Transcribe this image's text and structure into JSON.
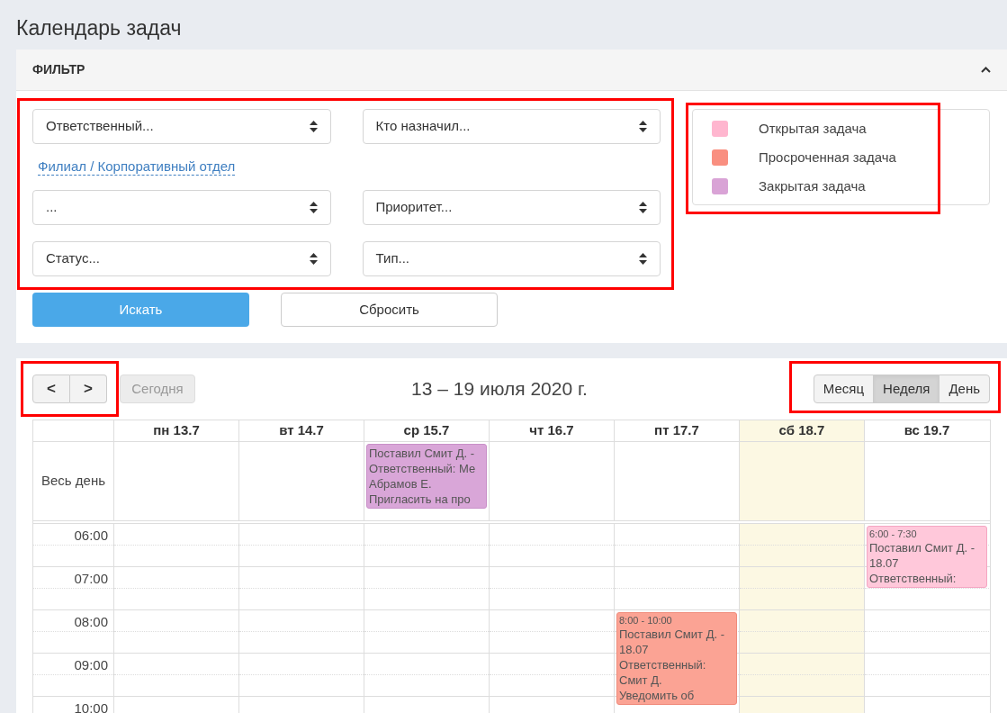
{
  "page_title": "Календарь задач",
  "filter": {
    "title": "ФИЛЬТР",
    "expanded": true,
    "highlighted": true,
    "selects_top": [
      {
        "placeholder": "Ответственный..."
      },
      {
        "placeholder": "Кто назначил..."
      }
    ],
    "branch_link": "Филиал / Корпоративный отдел",
    "selects_bottom": [
      {
        "placeholder": "..."
      },
      {
        "placeholder": "Приоритет..."
      },
      {
        "placeholder": "Статус..."
      },
      {
        "placeholder": "Тип..."
      }
    ],
    "search_button": "Искать",
    "reset_button": "Сбросить"
  },
  "legend": {
    "highlighted": true,
    "items": [
      {
        "label": "Открытая задача",
        "color": "#ffb6cf"
      },
      {
        "label": "Просроченная задача",
        "color": "#f98f80"
      },
      {
        "label": "Закрытая задача",
        "color": "#d9a3d6"
      }
    ]
  },
  "calendar": {
    "nav_highlighted": true,
    "views_highlighted": true,
    "prev": "<",
    "next": ">",
    "today_button": {
      "label": "Сегодня",
      "disabled": true
    },
    "title": "13 – 19 июля 2020 г.",
    "views": [
      {
        "label": "Месяц",
        "selected": false
      },
      {
        "label": "Неделя",
        "selected": true
      },
      {
        "label": "День",
        "selected": false
      }
    ],
    "days": [
      {
        "label": "пн 13.7",
        "today": false
      },
      {
        "label": "вт 14.7",
        "today": false
      },
      {
        "label": "ср 15.7",
        "today": false
      },
      {
        "label": "чт 16.7",
        "today": false
      },
      {
        "label": "пт 17.7",
        "today": false
      },
      {
        "label": "сб 18.7",
        "today": true
      },
      {
        "label": "вс 19.7",
        "today": false
      }
    ],
    "all_day": {
      "label": "Весь день",
      "cells": [
        null,
        null,
        {
          "kind": "closed",
          "lines": [
            "Поставил Смит Д. -",
            "Ответственный: Ме",
            "Абрамов Е.",
            "Пригласить на про"
          ]
        },
        null,
        null,
        null,
        null
      ]
    },
    "hours": [
      {
        "label": "06:00",
        "cells": [
          null,
          null,
          null,
          null,
          null,
          null,
          {
            "kind": "open",
            "time": "6:00 - 7:30",
            "lines": [
              "Поставил Смит Д. -",
              "18.07",
              "Ответственный:"
            ]
          }
        ]
      },
      {
        "label": "07:00",
        "cells": [
          null,
          null,
          null,
          null,
          null,
          null,
          null
        ]
      },
      {
        "label": "08:00",
        "cells": [
          null,
          null,
          null,
          null,
          {
            "kind": "overdue",
            "time": "8:00 - 10:00",
            "lines": [
              "Поставил Смит Д. -",
              "18.07",
              "Ответственный:",
              "Смит Д.",
              "Уведомить об"
            ]
          },
          null,
          null
        ]
      },
      {
        "label": "09:00",
        "cells": [
          null,
          null,
          null,
          null,
          null,
          null,
          null
        ]
      },
      {
        "label": "10:00",
        "cells": [
          null,
          null,
          null,
          null,
          null,
          null,
          null
        ]
      }
    ]
  }
}
